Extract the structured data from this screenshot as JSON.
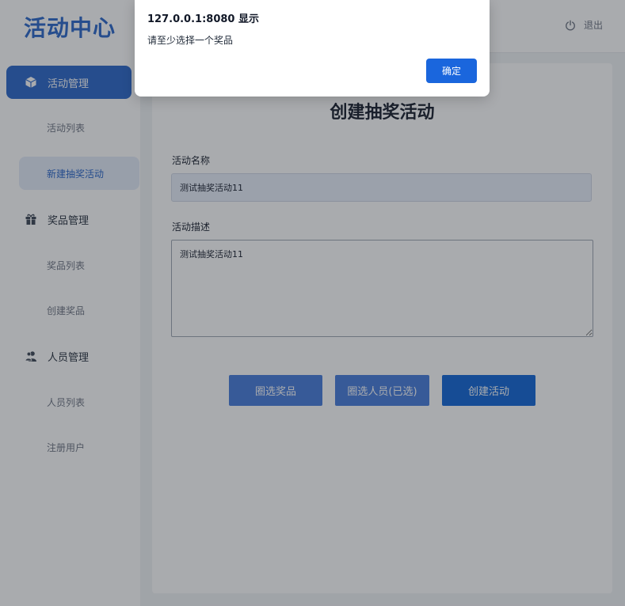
{
  "header": {
    "logo": "活动中心",
    "logout_label": "退出"
  },
  "sidebar": {
    "groups": [
      {
        "label": "活动管理",
        "icon": "cube-icon",
        "items": [
          "活动列表",
          "新建抽奖活动"
        ]
      },
      {
        "label": "奖品管理",
        "icon": "gift-icon",
        "items": [
          "奖品列表",
          "创建奖品"
        ]
      },
      {
        "label": "人员管理",
        "icon": "users-icon",
        "items": [
          "人员列表",
          "注册用户"
        ]
      }
    ]
  },
  "form": {
    "title": "创建抽奖活动",
    "name_label": "活动名称",
    "name_value": "测试抽奖活动11",
    "desc_label": "活动描述",
    "desc_value": "测试抽奖活动11",
    "buttons": {
      "select_prize": "圈选奖品",
      "select_people": "圈选人员(已选)",
      "create": "创建活动"
    }
  },
  "dialog": {
    "title": "127.0.0.1:8080 显示",
    "message": "请至少选择一个奖品",
    "ok": "确定"
  },
  "colors": {
    "accent": "#2563c9",
    "button": "#4178da",
    "primary_button": "#0a62d6",
    "overlay": "rgba(40,44,52,0.40)"
  }
}
